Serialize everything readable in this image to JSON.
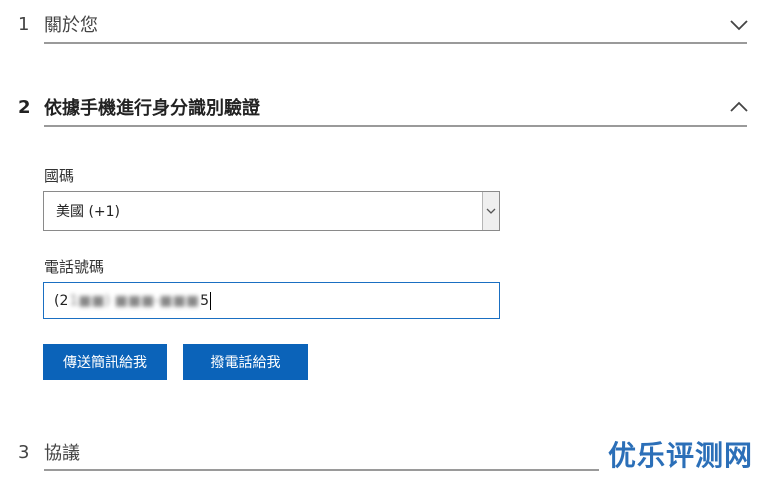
{
  "sections": [
    {
      "number": "1",
      "title": "關於您"
    },
    {
      "number": "2",
      "title": "依據手機進行身分識別驗證"
    },
    {
      "number": "3",
      "title": "協議"
    }
  ],
  "country_code": {
    "label": "國碼",
    "selected": "美國 (+1)"
  },
  "phone": {
    "label": "電話號碼",
    "prefix": "(2",
    "masked_middle": "1■■) ■■■-■■■",
    "suffix": "5"
  },
  "buttons": {
    "send_sms": "傳送簡訊給我",
    "call_me": "撥電話給我"
  },
  "watermark": "优乐评测网",
  "icons": {
    "section1": "chevron-down-icon",
    "section2": "chevron-up-icon",
    "select": "chevron-down-icon"
  },
  "colors": {
    "primary": "#0b63b9",
    "watermark": "#2b6fb8"
  }
}
